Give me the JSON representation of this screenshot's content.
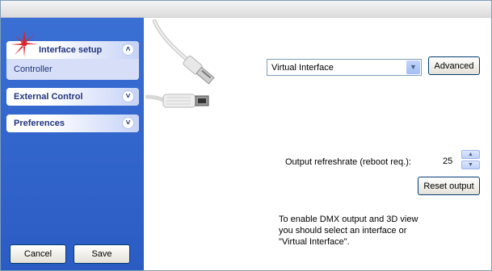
{
  "sidebar": {
    "panels": [
      {
        "label": "Interface setup",
        "state": "expanded",
        "items": [
          "Controller"
        ],
        "chevron": "double-chevron-up-icon"
      },
      {
        "label": "External Control",
        "state": "collapsed",
        "chevron": "double-chevron-down-icon"
      },
      {
        "label": "Preferences",
        "state": "collapsed",
        "chevron": "double-chevron-down-icon"
      }
    ],
    "cancel_label": "Cancel",
    "save_label": "Save",
    "logo_icon": "starburst-logo-icon"
  },
  "main": {
    "interface_select": {
      "value": "Virtual Interface"
    },
    "advanced_label": "Advanced",
    "refresh": {
      "label": "Output refreshrate (reboot req.):",
      "value": "25"
    },
    "reset_label": "Reset output",
    "info_lines": [
      "To enable DMX output and 3D view",
      "you should select an interface or",
      "\"Virtual Interface\"."
    ],
    "images": [
      "usb-cable-image",
      "usb-connector-image"
    ]
  },
  "colors": {
    "sidebar": "#2f63cc",
    "panel_text": "#21347c",
    "button_border": "#003c74"
  }
}
